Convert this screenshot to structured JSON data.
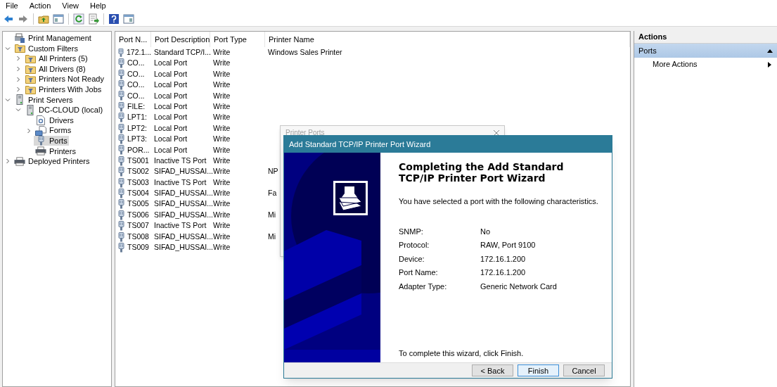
{
  "menu_bar": [
    "File",
    "Action",
    "View",
    "Help"
  ],
  "toolbar": [
    {
      "kind": "back",
      "disabled": false
    },
    {
      "kind": "forward",
      "disabled": true
    },
    {
      "kind": "up"
    },
    {
      "kind": "tree-toggle"
    },
    {
      "kind": "refresh"
    },
    {
      "kind": "export"
    },
    {
      "kind": "help"
    },
    {
      "kind": "action-pane"
    }
  ],
  "tree": [
    {
      "label": "Print Management",
      "kind": "root",
      "selected": false,
      "children": [
        {
          "label": "Custom Filters",
          "kind": "folder",
          "expanded": true,
          "selected": false,
          "children": [
            {
              "label": "All Printers (5)",
              "kind": "filter",
              "expanded": false,
              "selected": false
            },
            {
              "label": "All Drivers (8)",
              "kind": "filter",
              "expanded": false,
              "selected": false
            },
            {
              "label": "Printers Not Ready",
              "kind": "filter",
              "expanded": false,
              "selected": false
            },
            {
              "label": "Printers With Jobs",
              "kind": "filter",
              "expanded": false,
              "selected": false
            }
          ]
        },
        {
          "label": "Print Servers",
          "kind": "server",
          "expanded": true,
          "selected": false,
          "children": [
            {
              "label": "DC-CLOUD (local)",
              "kind": "server",
              "expanded": true,
              "selected": false,
              "children": [
                {
                  "label": "Drivers",
                  "kind": "drivers",
                  "selected": false
                },
                {
                  "label": "Forms",
                  "kind": "forms",
                  "expanded": false,
                  "selected": false
                },
                {
                  "label": "Ports",
                  "kind": "port",
                  "selected": true
                },
                {
                  "label": "Printers",
                  "kind": "printer",
                  "selected": false
                }
              ]
            }
          ]
        },
        {
          "label": "Deployed Printers",
          "kind": "printer",
          "expanded": false,
          "selected": false
        }
      ]
    }
  ],
  "table": {
    "columns": [
      "Port N...",
      "Port Description",
      "Port Type",
      "Printer Name"
    ],
    "rows": [
      [
        "172.1...",
        "Standard TCP/I...",
        "Write",
        "Windows Sales Printer"
      ],
      [
        "CO...",
        "Local Port",
        "Write"
      ],
      [
        "CO...",
        "Local Port",
        "Write"
      ],
      [
        "CO...",
        "Local Port",
        "Write"
      ],
      [
        "CO...",
        "Local Port",
        "Write"
      ],
      [
        "FILE:",
        "Local Port",
        "Write"
      ],
      [
        "LPT1:",
        "Local Port",
        "Write"
      ],
      [
        "LPT2:",
        "Local Port",
        "Write"
      ],
      [
        "LPT3:",
        "Local Port",
        "Write"
      ],
      [
        "POR...",
        "Local Port",
        "Write"
      ],
      [
        "TS001",
        "Inactive TS Port",
        "Write"
      ],
      [
        "TS002",
        "SIFAD_HUSSAI...",
        "Write",
        "NP"
      ],
      [
        "TS003",
        "Inactive TS Port",
        "Write"
      ],
      [
        "TS004",
        "SIFAD_HUSSAI...",
        "Write",
        "Fa"
      ],
      [
        "TS005",
        "SIFAD_HUSSAI...",
        "Write"
      ],
      [
        "TS006",
        "SIFAD_HUSSAI...",
        "Write",
        "Mi"
      ],
      [
        "TS007",
        "Inactive TS Port",
        "Write"
      ],
      [
        "TS008",
        "SIFAD_HUSSAI...",
        "Write",
        "Mi"
      ],
      [
        "TS009",
        "SIFAD_HUSSAI...",
        "Write"
      ]
    ]
  },
  "actions": {
    "title": "Actions",
    "section": {
      "label": "Ports",
      "expanded": true
    },
    "items": [
      {
        "label": "More Actions"
      }
    ]
  },
  "back_dialog": {
    "title": "Printer Ports"
  },
  "wizard": {
    "title": "Add Standard TCP/IP Printer Port Wizard",
    "heading": "Completing the Add Standard TCP/IP Printer Port Wizard",
    "intro": "You have selected a port with the following characteristics.",
    "fields": [
      {
        "label": "SNMP:",
        "value": "No"
      },
      {
        "label": "Protocol:",
        "value": "RAW, Port 9100"
      },
      {
        "label": "Device:",
        "value": "172.16.1.200"
      },
      {
        "label": "Port Name:",
        "value": "172.16.1.200"
      },
      {
        "label": "Adapter Type:",
        "value": "Generic Network Card"
      }
    ],
    "footer": "To complete this wizard, click Finish.",
    "buttons": [
      {
        "label": "< Back",
        "default": false
      },
      {
        "label": "Finish",
        "default": true
      },
      {
        "label": "Cancel",
        "default": false
      }
    ]
  }
}
